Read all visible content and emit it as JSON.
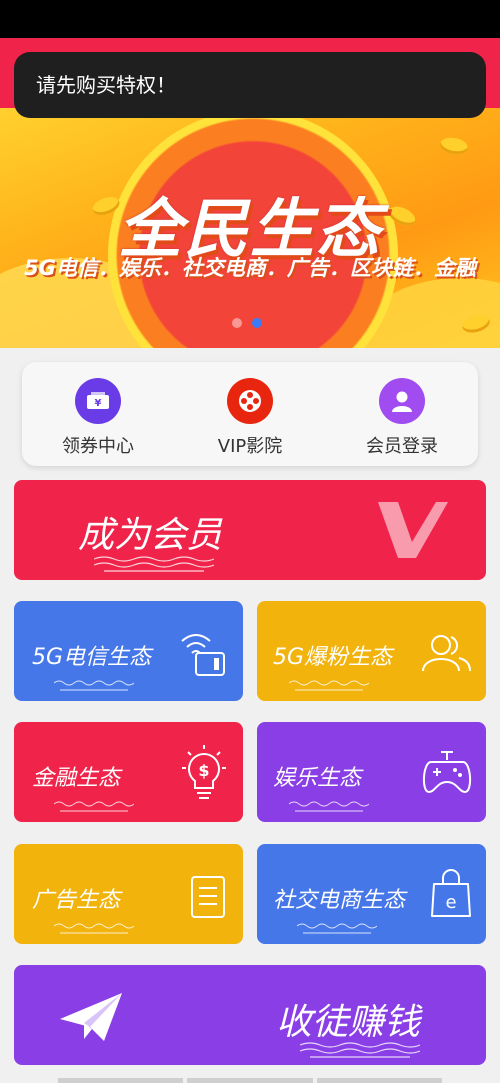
{
  "toast": {
    "message": "请先购买特权！"
  },
  "banner": {
    "title": "全民生态",
    "subtitle": "5G电信．娱乐．社交电商．广告．区块链．金融",
    "page_count": 2,
    "active_page": 2
  },
  "quick_links": [
    {
      "label": "领券中心",
      "icon": "coupon-icon",
      "color": "#6a3ce8"
    },
    {
      "label": "VIP影院",
      "icon": "film-reel-icon",
      "color": "#e8260f"
    },
    {
      "label": "会员登录",
      "icon": "user-icon",
      "color": "#a04cf0"
    }
  ],
  "tiles": {
    "member": {
      "label": "成为会员",
      "color": "#f0244a"
    },
    "telecom": {
      "label": "5G电信生态",
      "color": "#4577e8"
    },
    "fans": {
      "label": "5G爆粉生态",
      "color": "#f1b30c"
    },
    "finance": {
      "label": "金融生态",
      "color": "#f0244a"
    },
    "entertainment": {
      "label": "娱乐生态",
      "color": "#8a3fe6"
    },
    "ads": {
      "label": "广告生态",
      "color": "#f1b30c"
    },
    "social": {
      "label": "社交电商生态",
      "color": "#4577e8"
    },
    "recruit": {
      "label": "收徒赚钱",
      "color": "#8a3fe6"
    }
  }
}
